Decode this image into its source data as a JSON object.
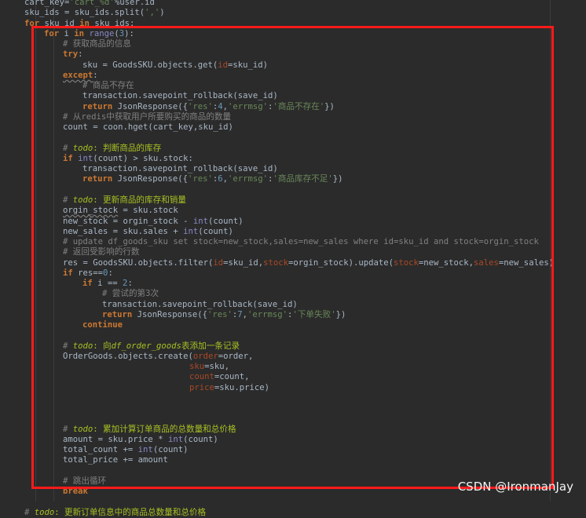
{
  "editor": {
    "lines": [
      [
        [
          "cart_key=",
          ""
        ],
        [
          "'cart_%d'",
          "str"
        ],
        [
          "%user.id",
          ""
        ]
      ],
      [
        [
          "sku_ids = sku_ids.split(",
          ""
        ],
        [
          "','",
          "str"
        ],
        [
          ")",
          ""
        ]
      ],
      [
        [
          "for",
          "kw"
        ],
        [
          " sku_id ",
          ""
        ],
        [
          "in",
          "kw"
        ],
        [
          " sku_ids:",
          ""
        ]
      ],
      [
        [
          "for",
          "kw"
        ],
        [
          " i ",
          ""
        ],
        [
          "in",
          "kw"
        ],
        [
          " ",
          ""
        ],
        [
          "range",
          "bi"
        ],
        [
          "(",
          ""
        ],
        [
          "3",
          "num"
        ],
        [
          "):",
          ""
        ]
      ],
      [
        [
          "# 获取商品的信息",
          "cm"
        ]
      ],
      [
        [
          "try",
          "kw"
        ],
        [
          ":",
          ""
        ]
      ],
      [
        [
          "sku = GoodsSKU.objects.get(",
          ""
        ],
        [
          "id",
          "kwarg"
        ],
        [
          "=sku_id)",
          ""
        ]
      ],
      [
        [
          "except",
          "kw warn"
        ],
        [
          ":",
          ""
        ]
      ],
      [
        [
          "# 商品不存在",
          "cm"
        ]
      ],
      [
        [
          "transaction.savepoint_rollback(save_id)",
          ""
        ]
      ],
      [
        [
          "return",
          "kw"
        ],
        [
          " JsonResponse({",
          ""
        ],
        [
          "'res'",
          "str"
        ],
        [
          ":",
          ""
        ],
        [
          "4",
          "num"
        ],
        [
          ",",
          ""
        ],
        [
          "'errmsg'",
          "str"
        ],
        [
          ":",
          ""
        ],
        [
          "'商品不存在'",
          "str"
        ],
        [
          "})",
          ""
        ]
      ],
      [
        [
          "# 从redis中获取用户所要购买的商品的数量",
          "cm"
        ]
      ],
      [
        [
          "count = coon.hget(cart_key,sku_id)",
          ""
        ]
      ],
      [],
      [
        [
          "# ",
          "cm"
        ],
        [
          "todo",
          "todo-i"
        ],
        [
          ": 判断商品的库存",
          "todo"
        ]
      ],
      [
        [
          "if",
          "kw"
        ],
        [
          " ",
          ""
        ],
        [
          "int",
          "bi"
        ],
        [
          "(count) > sku.stock:",
          ""
        ]
      ],
      [
        [
          "transaction.savepoint_rollback(save_id)",
          ""
        ]
      ],
      [
        [
          "return",
          "kw"
        ],
        [
          " JsonResponse({",
          ""
        ],
        [
          "'res'",
          "str"
        ],
        [
          ":",
          ""
        ],
        [
          "6",
          "num"
        ],
        [
          ",",
          ""
        ],
        [
          "'errmsg'",
          "str"
        ],
        [
          ":",
          ""
        ],
        [
          "'商品库存不足'",
          "str"
        ],
        [
          "})",
          ""
        ]
      ],
      [],
      [
        [
          "# ",
          "cm"
        ],
        [
          "todo",
          "todo-i"
        ],
        [
          ": 更新商品的库存和销量",
          "todo"
        ]
      ],
      [
        [
          "orgin_stock",
          "warn"
        ],
        [
          " = sku.stock",
          ""
        ]
      ],
      [
        [
          "new_stock = orgin_stock - ",
          ""
        ],
        [
          "int",
          "bi"
        ],
        [
          "(count)",
          ""
        ]
      ],
      [
        [
          "new_sales = sku.sales + ",
          ""
        ],
        [
          "int",
          "bi"
        ],
        [
          "(count)",
          ""
        ]
      ],
      [
        [
          "# update df_goods_sku set stock=new_stock,sales=new_sales where id=sku_id and stock=orgin_stock",
          "cm"
        ]
      ],
      [
        [
          "# 返回受影响的行数",
          "cm"
        ]
      ],
      [
        [
          "res = GoodsSKU.objects.filter(",
          ""
        ],
        [
          "id",
          "kwarg"
        ],
        [
          "=sku_id,",
          ""
        ],
        [
          "stock",
          "kwarg"
        ],
        [
          "=orgin_stock).update(",
          ""
        ],
        [
          "stock",
          "kwarg"
        ],
        [
          "=new_stock,",
          ""
        ],
        [
          "sales",
          "kwarg"
        ],
        [
          "=new_sales)",
          ""
        ]
      ],
      [
        [
          "if",
          "kw"
        ],
        [
          " res==",
          ""
        ],
        [
          "0",
          "num"
        ],
        [
          ":",
          ""
        ]
      ],
      [
        [
          "if",
          "kw"
        ],
        [
          " i == ",
          ""
        ],
        [
          "2",
          "num"
        ],
        [
          ":",
          ""
        ]
      ],
      [
        [
          "# 尝试的第3次",
          "cm"
        ]
      ],
      [
        [
          "transaction.savepoint_rollback(save_id)",
          ""
        ]
      ],
      [
        [
          "return",
          "kw"
        ],
        [
          " JsonResponse({",
          ""
        ],
        [
          "'res'",
          "str"
        ],
        [
          ":",
          ""
        ],
        [
          "7",
          "num"
        ],
        [
          ",",
          ""
        ],
        [
          "'errmsg'",
          "str"
        ],
        [
          ":",
          ""
        ],
        [
          "'下单失败'",
          "str"
        ],
        [
          "})",
          ""
        ]
      ],
      [
        [
          "continue",
          "kw"
        ]
      ],
      [],
      [
        [
          "# ",
          "cm"
        ],
        [
          "todo",
          "todo-i"
        ],
        [
          ": 向",
          "todo"
        ],
        [
          "df_order_goods",
          "todo-i"
        ],
        [
          "表添加一条记录",
          "todo"
        ]
      ],
      [
        [
          "OrderGoods.objects.create(",
          ""
        ],
        [
          "order",
          "kwarg"
        ],
        [
          "=order,",
          ""
        ]
      ],
      [
        [
          "sku",
          "kwarg"
        ],
        [
          "=sku,",
          ""
        ]
      ],
      [
        [
          "count",
          "kwarg"
        ],
        [
          "=count,",
          ""
        ]
      ],
      [
        [
          "price",
          "kwarg"
        ],
        [
          "=sku.price)",
          ""
        ]
      ],
      [],
      [],
      [],
      [
        [
          "# ",
          "cm"
        ],
        [
          "todo",
          "todo-i"
        ],
        [
          ": 累加计算订单商品的总数量和总价格",
          "todo"
        ]
      ],
      [
        [
          "amount = sku.price * ",
          ""
        ],
        [
          "int",
          "bi"
        ],
        [
          "(count)",
          ""
        ]
      ],
      [
        [
          "total_count += ",
          ""
        ],
        [
          "int",
          "bi"
        ],
        [
          "(count)",
          ""
        ]
      ],
      [
        [
          "total_price += amount",
          ""
        ]
      ],
      [],
      [
        [
          "# 跳出循环",
          "cm"
        ]
      ],
      [
        [
          "break",
          "kw"
        ]
      ],
      [],
      [
        [
          "# ",
          "cm"
        ],
        [
          "todo",
          "todo-i"
        ],
        [
          ": 更新订单信息中的商品总数量和总价格",
          "todo"
        ]
      ]
    ]
  },
  "watermark": "CSDN @IronmanJay",
  "colors": {
    "background": "#2b2b2b",
    "annotation_box": "#ff1a1a"
  }
}
